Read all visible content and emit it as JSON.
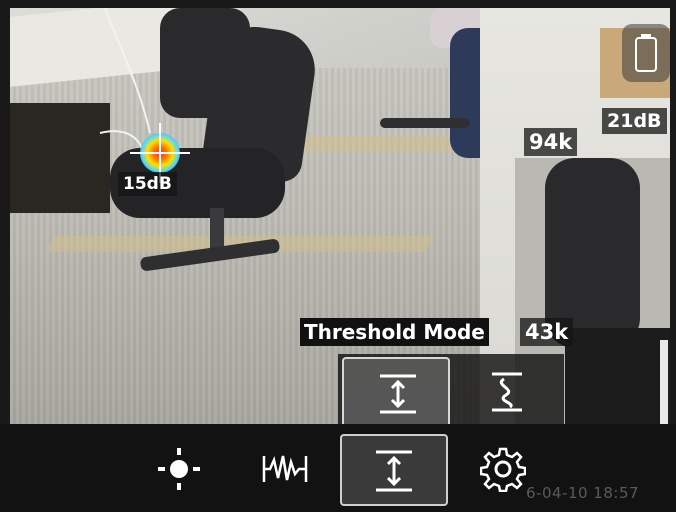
{
  "overlays": {
    "spot_level": "15dB",
    "max_level": "21dB",
    "freq_top": "94k",
    "freq_bottom": "43k"
  },
  "threshold_panel": {
    "title": "Threshold Mode",
    "options": [
      {
        "name": "fixed-threshold",
        "icon": "threshold-fixed-icon",
        "selected": true
      },
      {
        "name": "auto-threshold",
        "icon": "threshold-auto-icon",
        "selected": false
      }
    ]
  },
  "toolbar": {
    "buttons": [
      {
        "name": "brightness",
        "icon": "brightness-icon"
      },
      {
        "name": "waveform",
        "icon": "waveform-icon"
      },
      {
        "name": "threshold",
        "icon": "threshold-fixed-icon",
        "selected": true
      },
      {
        "name": "settings",
        "icon": "gear-icon"
      }
    ]
  },
  "status": {
    "timestamp": "6-04-10 18:57"
  },
  "colors": {
    "accent_selected_border": "#d8d8d8",
    "overlay_bg": "#111111",
    "icon_white": "#ffffff"
  }
}
